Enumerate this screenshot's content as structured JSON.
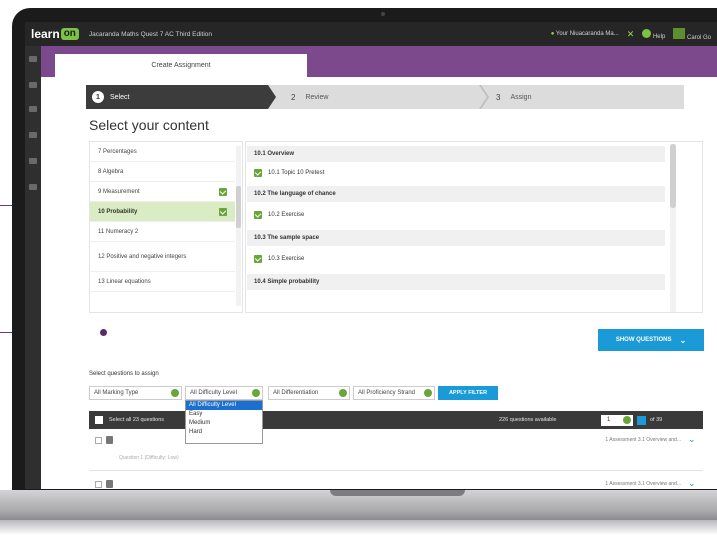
{
  "app": {
    "logo_text": "learn",
    "logo_badge": "on",
    "course_title": "Jacaranda Maths Quest 7 AC Third Edition",
    "user_label": "Your Niuacaranda Ma...",
    "help_label": "Help",
    "home_label": "Carol Go"
  },
  "tab": {
    "label": "Create Assignment"
  },
  "steps": [
    {
      "num": "1",
      "label": "Select"
    },
    {
      "num": "2",
      "label": "Review"
    },
    {
      "num": "3",
      "label": "Assign"
    }
  ],
  "heading": "Select your content",
  "chapters": [
    {
      "label": "7 Percentages",
      "checked": false,
      "active": false
    },
    {
      "label": "8 Algebra",
      "checked": false,
      "active": false
    },
    {
      "label": "9 Measurement",
      "checked": true,
      "active": false
    },
    {
      "label": "10 Probability",
      "checked": true,
      "active": true
    },
    {
      "label": "11 Numeracy 2",
      "checked": false,
      "active": false
    },
    {
      "label": "12 Positive and negative integers",
      "checked": false,
      "active": false
    },
    {
      "label": "13 Linear equations",
      "checked": false,
      "active": false
    }
  ],
  "subtopics": [
    {
      "label": "10.1 Overview",
      "head": true
    },
    {
      "label": "10.1 Topic 10 Pretest",
      "head": false
    },
    {
      "label": "10.2 The language of chance",
      "head": true
    },
    {
      "label": "10.2 Exercise",
      "head": false
    },
    {
      "label": "10.3 The sample space",
      "head": true
    },
    {
      "label": "10.3 Exercise",
      "head": false
    },
    {
      "label": "10.4 Simple probability",
      "head": true
    }
  ],
  "show_questions": {
    "label": "SHOW QUESTIONS",
    "icon": "chevron-down-icon"
  },
  "filters": {
    "title": "Select questions to assign",
    "marking": "All Marking Type",
    "difficulty": "All Difficulty Level",
    "differentiation": "All Differentiation",
    "proficiency": "All Proficiency Strand",
    "apply": "APPLY FILTER",
    "difficulty_options": [
      "All Difficulty Level",
      "Easy",
      "Medium",
      "Hard"
    ]
  },
  "question_bar": {
    "select_all": "Select all 23 questions",
    "available": "226 questions available",
    "per_page": "1",
    "of_pages": "of 39"
  },
  "questions": [
    {
      "crumb": "1 Assessment 3.1 Overview and...",
      "hint": "Question 1 (Difficulty: Low)"
    },
    {
      "crumb": "1 Assessment 3.1 Overview and...",
      "hint": ""
    }
  ],
  "colors": {
    "brand_purple": "#7c4a8c",
    "accent_blue": "#1a9ad6",
    "check_green": "#6aa53a",
    "logo_green": "#7dc243"
  }
}
